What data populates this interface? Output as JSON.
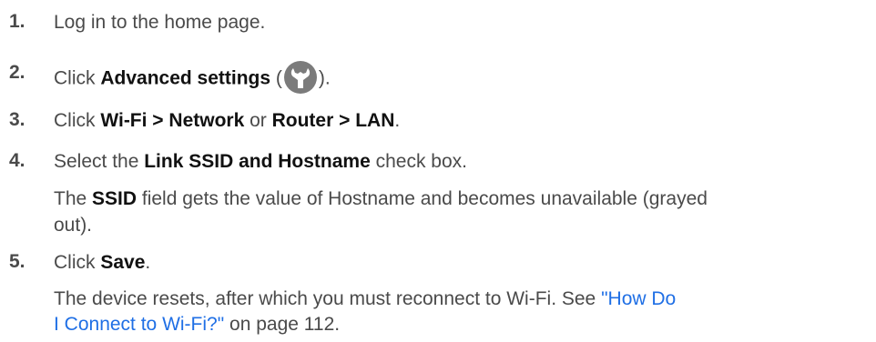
{
  "steps": [
    {
      "number": "1.",
      "text": "Log in to the home page."
    },
    {
      "number": "2.",
      "prefix": "Click ",
      "bold": "Advanced settings",
      "paren_open": " (",
      "icon": "wrench-icon",
      "paren_close": ")."
    },
    {
      "number": "3.",
      "prefix": "Click ",
      "bold1": "Wi-Fi > Network",
      "mid": " or ",
      "bold2": "Router > LAN",
      "suffix": "."
    },
    {
      "number": "4.",
      "prefix": "Select the ",
      "bold": "Link SSID and Hostname",
      "suffix": " check box.",
      "note_prefix": "The ",
      "note_bold": "SSID",
      "note_line1_rest": " field gets the value of Hostname and becomes unavailable (grayed",
      "note_line2": "out)."
    },
    {
      "number": "5.",
      "prefix": "Click ",
      "bold": "Save",
      "suffix": ".",
      "note_line1_text": "The device resets, after which you must reconnect to Wi-Fi. See ",
      "link_part1": "\"How Do",
      "link_part2": "I Connect to Wi-Fi?\"",
      "note_line2_rest": " on page 112."
    }
  ],
  "colors": {
    "text": "#4a4a4a",
    "emphasis": "#111111",
    "link": "#1f6fe5",
    "icon_bg": "#7b7b7b"
  }
}
